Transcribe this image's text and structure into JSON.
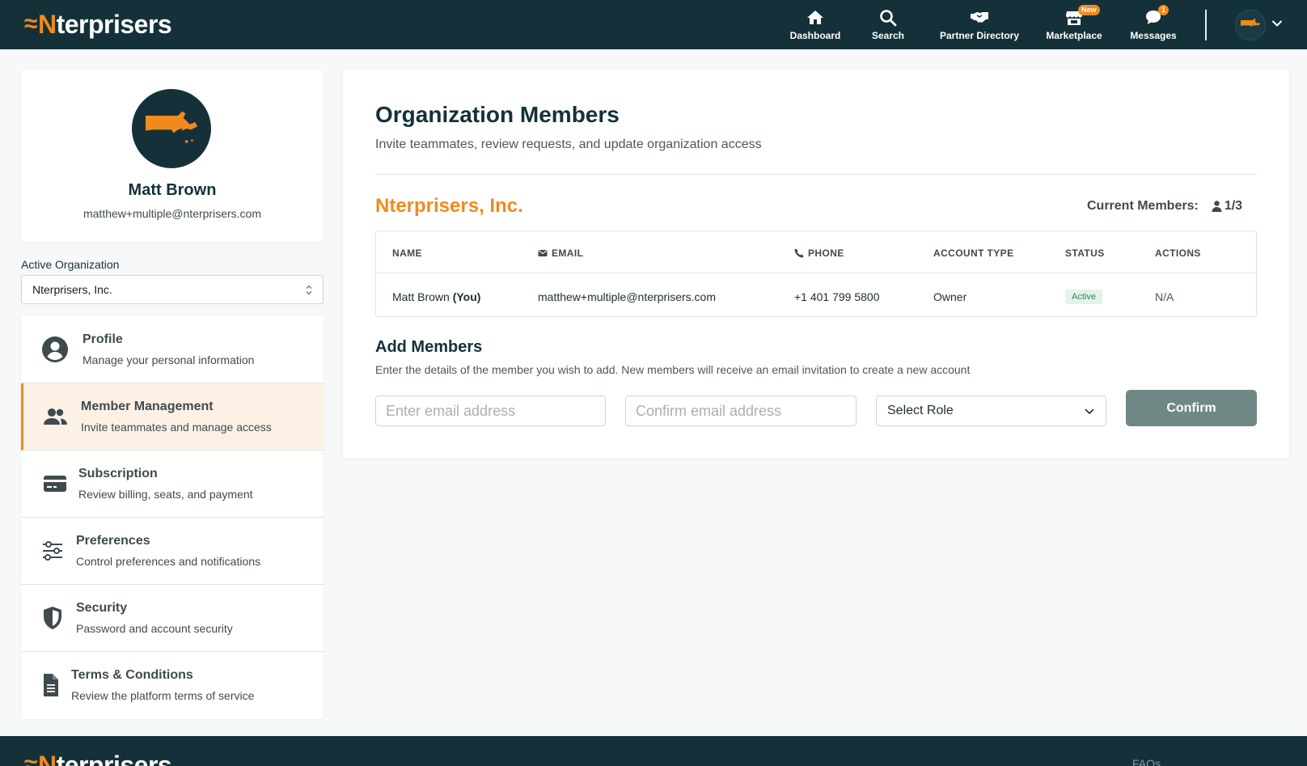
{
  "brand": {
    "logo_mark": "≈",
    "logo_first": "N",
    "logo_rest": "terprisers"
  },
  "nav": {
    "items": [
      {
        "label": "Dashboard",
        "icon": "home-icon"
      },
      {
        "label": "Search",
        "icon": "search-icon"
      },
      {
        "label": "Partner Directory",
        "icon": "handshake-icon"
      },
      {
        "label": "Marketplace",
        "icon": "store-icon",
        "badge": "New"
      },
      {
        "label": "Messages",
        "icon": "chat-icon",
        "badge": "1"
      }
    ]
  },
  "profile": {
    "name": "Matt Brown",
    "email": "matthew+multiple@nterprisers.com"
  },
  "active_org": {
    "label": "Active Organization",
    "selected": "Nterprisers, Inc."
  },
  "menu": {
    "items": [
      {
        "title": "Profile",
        "desc": "Manage your personal information"
      },
      {
        "title": "Member Management",
        "desc": "Invite teammates and manage access"
      },
      {
        "title": "Subscription",
        "desc": "Review billing, seats, and payment"
      },
      {
        "title": "Preferences",
        "desc": "Control preferences and notifications"
      },
      {
        "title": "Security",
        "desc": "Password and account security"
      },
      {
        "title": "Terms & Conditions",
        "desc": "Review the platform terms of service"
      }
    ]
  },
  "main": {
    "title": "Organization Members",
    "subtitle": "Invite teammates, review requests, and update organization access",
    "org_name": "Nterprisers, Inc.",
    "members_label": "Current Members:",
    "members_count": "1/3",
    "table": {
      "headers": [
        "NAME",
        "EMAIL",
        "PHONE",
        "ACCOUNT TYPE",
        "STATUS",
        "ACTIONS"
      ],
      "rows": [
        {
          "name": "Matt Brown",
          "name_suffix": "(You)",
          "email": "matthew+multiple@nterprisers.com",
          "phone": "+1 401 799 5800",
          "account_type": "Owner",
          "status": "Active",
          "actions": "N/A"
        }
      ]
    },
    "add": {
      "title": "Add Members",
      "desc": "Enter the details of the member you wish to add. New members will receive an email invitation to create a new account",
      "email_placeholder": "Enter email address",
      "confirm_placeholder": "Confirm email address",
      "role_placeholder": "Select Role",
      "confirm_label": "Confirm"
    }
  },
  "footer": {
    "link": "FAQs"
  },
  "colors": {
    "navy": "#14313a",
    "accent": "#f08a1c",
    "button": "#6f8886",
    "active_bg": "#fdf1e6",
    "status_green": "#2d8a4e"
  }
}
